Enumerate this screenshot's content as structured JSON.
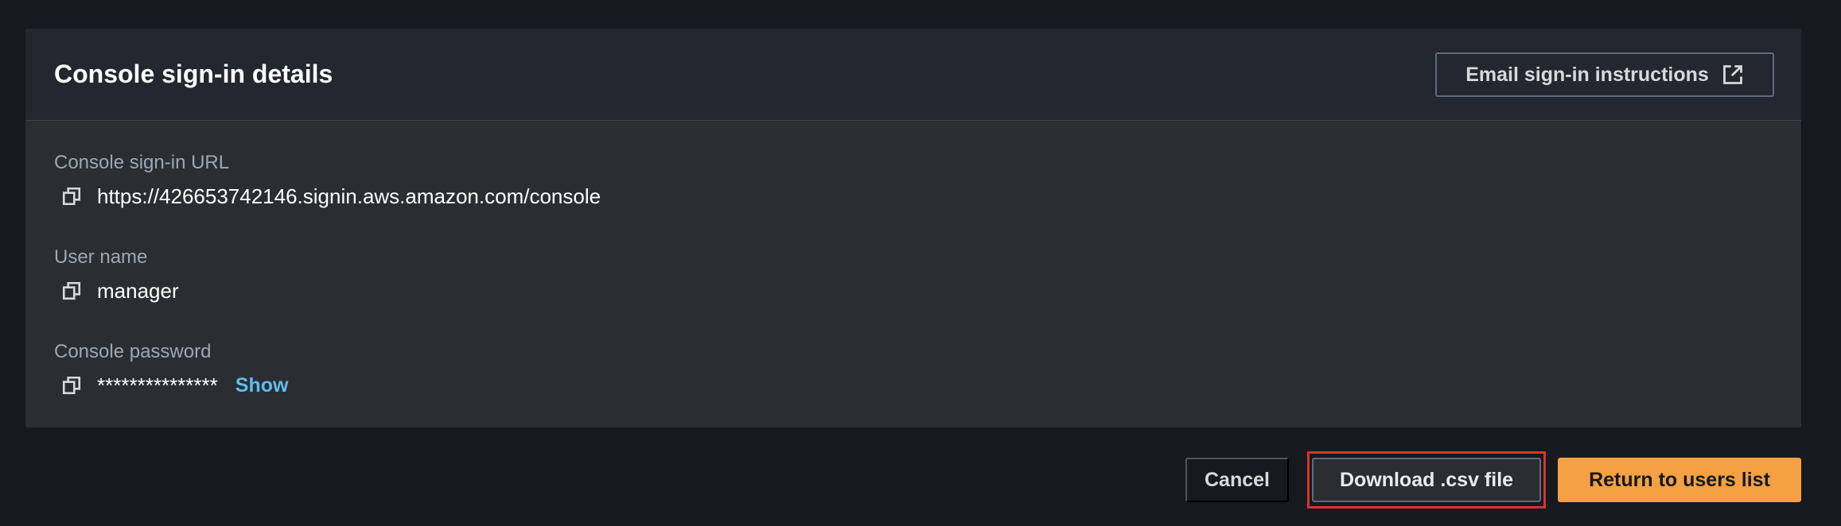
{
  "panel": {
    "title": "Console sign-in details",
    "email_button_label": "Email sign-in instructions"
  },
  "fields": [
    {
      "label": "Console sign-in URL",
      "value": "https://426653742146.signin.aws.amazon.com/console"
    },
    {
      "label": "User name",
      "value": "manager"
    },
    {
      "label": "Console password",
      "value": "***************",
      "show_label": "Show"
    }
  ],
  "footer": {
    "cancel_label": "Cancel",
    "download_label": "Download .csv file",
    "return_label": "Return to users list"
  },
  "colors": {
    "background": "#16191f",
    "panel": "#2a2e33",
    "link": "#5fbcea",
    "primary_button": "#f5a042",
    "highlight": "#d8342b"
  },
  "icons": {
    "external_link": "external-link-icon",
    "copy": "copy-icon"
  }
}
